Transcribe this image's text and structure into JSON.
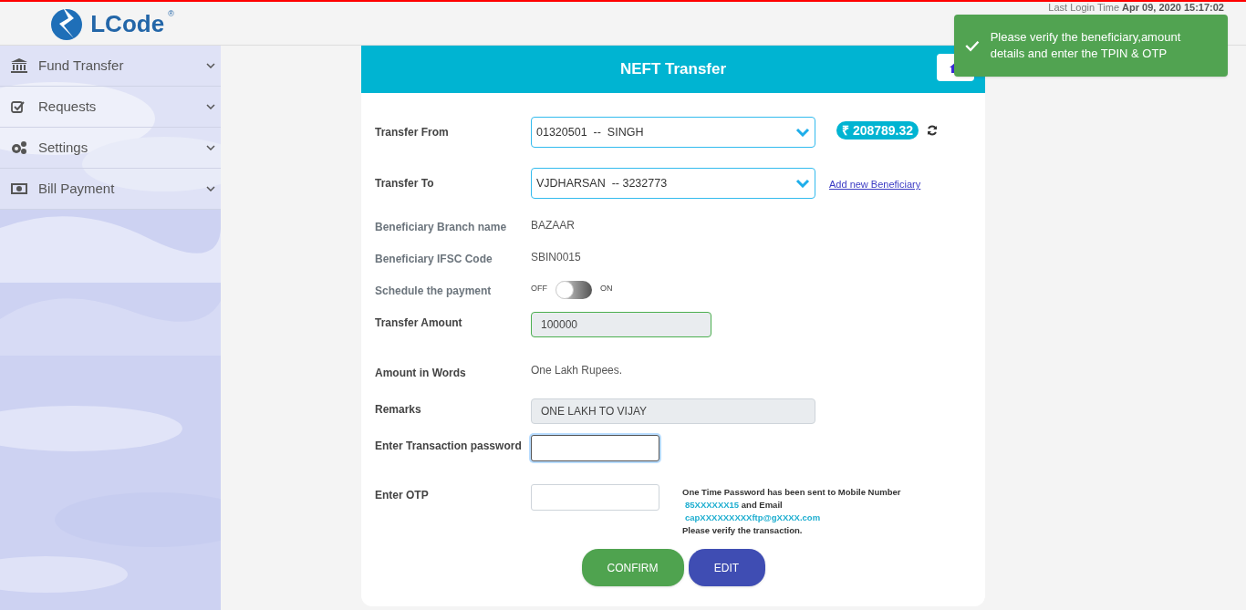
{
  "logo": {
    "text": "LCode",
    "mark": "®"
  },
  "last_login": {
    "label": "Last Login Time",
    "value": "Apr 09, 2020 15:17:02"
  },
  "sidebar": {
    "items": [
      {
        "label": "Fund Transfer"
      },
      {
        "label": "Requests"
      },
      {
        "label": "Settings"
      },
      {
        "label": "Bill Payment"
      }
    ]
  },
  "toast": {
    "message": "Please verify the beneficiary,amount details and enter the TPIN & OTP"
  },
  "card": {
    "title": "NEFT Transfer",
    "fields": [
      {
        "kind": "select",
        "label": "Transfer From",
        "value": "01320501  --  SINGH",
        "balance": "₹ 208789.32"
      },
      {
        "kind": "select",
        "label": "Transfer To",
        "value": "VJDHARSAN  -- 3232773",
        "link": "Add new Beneficiary"
      },
      {
        "kind": "text",
        "label": "Beneficiary Branch name",
        "value": "BAZAAR"
      },
      {
        "kind": "text",
        "label": "Beneficiary IFSC Code",
        "value": "SBIN0015"
      },
      {
        "kind": "toggle",
        "label": "Schedule the payment",
        "off_label": "OFF",
        "on_label": "ON",
        "on": false
      },
      {
        "kind": "readonly",
        "label": "Transfer Amount",
        "value": "100000",
        "valid": true
      },
      {
        "kind": "words",
        "label": "Amount in Words",
        "value": "One Lakh Rupees."
      },
      {
        "kind": "readonly",
        "label": "Remarks",
        "value": "ONE LAKH TO VIJAY",
        "valid": false
      },
      {
        "kind": "password",
        "label": "Enter Transaction password",
        "focused": true
      },
      {
        "kind": "otp",
        "label": "Enter OTP",
        "focused": false,
        "note": {
          "intro": "One Time Password has been sent to Mobile Number",
          "mobile": "85XXXXXX15",
          "and": "and Email",
          "email": "capXXXXXXXXXftp@gXXXX.com",
          "outro": "Please verify the transaction."
        }
      }
    ],
    "buttons": [
      {
        "label": "CONFIRM",
        "kind": "primary"
      },
      {
        "label": "EDIT",
        "kind": "secondary"
      }
    ]
  }
}
